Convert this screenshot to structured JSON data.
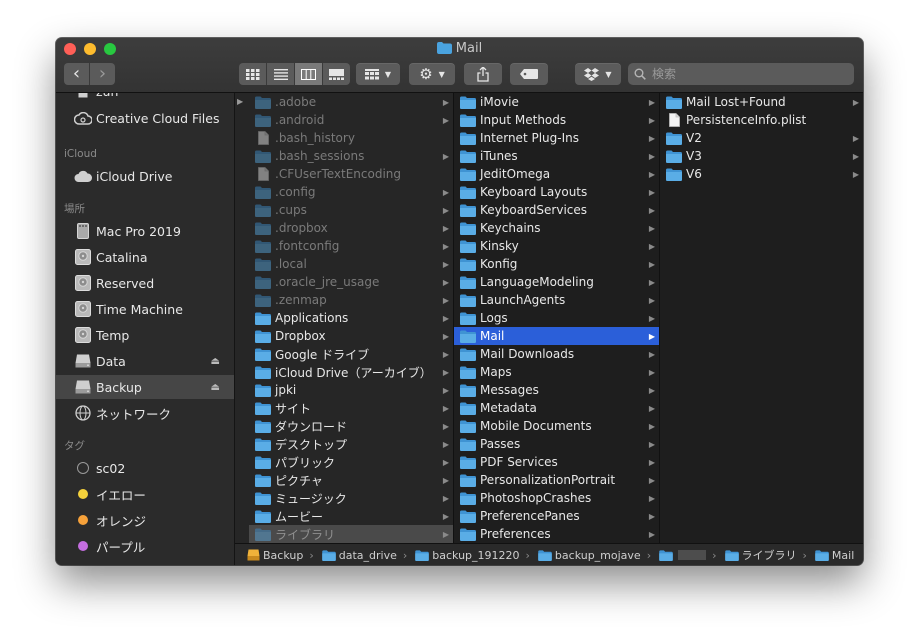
{
  "window": {
    "title": "Mail"
  },
  "toolbar": {
    "back": "‹",
    "forward": "›",
    "search_placeholder": "検索",
    "view_icons": [
      "icon-view-icon",
      "list-view-icon",
      "column-view-icon",
      "gallery-view-icon"
    ]
  },
  "sidebar": {
    "top_items": [
      {
        "label": "zun",
        "icon": "home-icon"
      },
      {
        "label": "Creative Cloud Files",
        "icon": "creative-cloud-icon"
      }
    ],
    "icloud_header": "iCloud",
    "icloud_items": [
      {
        "label": "iCloud Drive",
        "icon": "cloud-icon"
      }
    ],
    "places_header": "場所",
    "places_items": [
      {
        "label": "Mac Pro 2019",
        "icon": "computer-icon",
        "eject": false
      },
      {
        "label": "Catalina",
        "icon": "disk-icon",
        "eject": false
      },
      {
        "label": "Reserved",
        "icon": "disk-icon",
        "eject": false
      },
      {
        "label": "Time Machine",
        "icon": "disk-icon",
        "eject": false
      },
      {
        "label": "Temp",
        "icon": "disk-icon",
        "eject": false
      },
      {
        "label": "Data",
        "icon": "external-drive-icon",
        "eject": true
      },
      {
        "label": "Backup",
        "icon": "external-drive-icon",
        "eject": true,
        "selected": true
      },
      {
        "label": "ネットワーク",
        "icon": "network-icon",
        "eject": false
      }
    ],
    "tags_header": "タグ",
    "tags": [
      {
        "label": "sc02",
        "color": "#2b2b2b",
        "ring": "#9a9a9a"
      },
      {
        "label": "イエロー",
        "color": "#f5d23c"
      },
      {
        "label": "オレンジ",
        "color": "#f6a13a"
      },
      {
        "label": "パープル",
        "color": "#c56ee0"
      }
    ]
  },
  "columns": {
    "col1": [
      {
        "label": ".adobe",
        "type": "folder",
        "dim": true,
        "arrow": true
      },
      {
        "label": ".android",
        "type": "folder",
        "dim": true,
        "arrow": true
      },
      {
        "label": ".bash_history",
        "type": "file",
        "dim": true,
        "arrow": false
      },
      {
        "label": ".bash_sessions",
        "type": "folder",
        "dim": true,
        "arrow": true
      },
      {
        "label": ".CFUserTextEncoding",
        "type": "file",
        "dim": true,
        "arrow": false
      },
      {
        "label": ".config",
        "type": "folder",
        "dim": true,
        "arrow": true
      },
      {
        "label": ".cups",
        "type": "folder",
        "dim": true,
        "arrow": true
      },
      {
        "label": ".dropbox",
        "type": "folder",
        "dim": true,
        "arrow": true
      },
      {
        "label": ".fontconfig",
        "type": "folder",
        "dim": true,
        "arrow": true
      },
      {
        "label": ".local",
        "type": "folder",
        "dim": true,
        "arrow": true
      },
      {
        "label": ".oracle_jre_usage",
        "type": "folder",
        "dim": true,
        "arrow": true
      },
      {
        "label": ".zenmap",
        "type": "folder",
        "dim": true,
        "arrow": true
      },
      {
        "label": "Applications",
        "type": "folder",
        "arrow": true
      },
      {
        "label": "Dropbox",
        "type": "folder",
        "arrow": true
      },
      {
        "label": "Google ドライブ",
        "type": "folder",
        "arrow": true
      },
      {
        "label": "iCloud Drive（アーカイブ）",
        "type": "folder",
        "arrow": true
      },
      {
        "label": "jpki",
        "type": "folder",
        "arrow": true
      },
      {
        "label": "サイト",
        "type": "folder",
        "arrow": true
      },
      {
        "label": "ダウンロード",
        "type": "folder",
        "arrow": true
      },
      {
        "label": "デスクトップ",
        "type": "folder",
        "arrow": true
      },
      {
        "label": "パブリック",
        "type": "folder",
        "arrow": true
      },
      {
        "label": "ピクチャ",
        "type": "folder",
        "arrow": true
      },
      {
        "label": "ミュージック",
        "type": "folder",
        "arrow": true
      },
      {
        "label": "ムービー",
        "type": "folder",
        "arrow": true
      },
      {
        "label": "ライブラリ",
        "type": "folder",
        "dim": true,
        "arrow": true,
        "inactive_selected": true
      }
    ],
    "col2": [
      {
        "label": "iMovie",
        "type": "folder",
        "arrow": true
      },
      {
        "label": "Input Methods",
        "type": "folder",
        "arrow": true
      },
      {
        "label": "Internet Plug-Ins",
        "type": "folder",
        "arrow": true
      },
      {
        "label": "iTunes",
        "type": "folder",
        "arrow": true
      },
      {
        "label": "JeditOmega",
        "type": "folder",
        "arrow": true
      },
      {
        "label": "Keyboard Layouts",
        "type": "folder",
        "arrow": true
      },
      {
        "label": "KeyboardServices",
        "type": "folder",
        "arrow": true
      },
      {
        "label": "Keychains",
        "type": "folder",
        "arrow": true
      },
      {
        "label": "Kinsky",
        "type": "folder",
        "arrow": true
      },
      {
        "label": "Konfig",
        "type": "folder",
        "arrow": true
      },
      {
        "label": "LanguageModeling",
        "type": "folder",
        "arrow": true
      },
      {
        "label": "LaunchAgents",
        "type": "folder",
        "arrow": true
      },
      {
        "label": "Logs",
        "type": "folder",
        "arrow": true
      },
      {
        "label": "Mail",
        "type": "folder",
        "arrow": true,
        "selected": true
      },
      {
        "label": "Mail Downloads",
        "type": "folder",
        "arrow": true
      },
      {
        "label": "Maps",
        "type": "folder",
        "arrow": true
      },
      {
        "label": "Messages",
        "type": "folder",
        "arrow": true
      },
      {
        "label": "Metadata",
        "type": "folder",
        "arrow": true
      },
      {
        "label": "Mobile Documents",
        "type": "folder",
        "arrow": true
      },
      {
        "label": "Passes",
        "type": "folder",
        "arrow": true
      },
      {
        "label": "PDF Services",
        "type": "folder",
        "arrow": true
      },
      {
        "label": "PersonalizationPortrait",
        "type": "folder",
        "arrow": true
      },
      {
        "label": "PhotoshopCrashes",
        "type": "folder",
        "arrow": true
      },
      {
        "label": "PreferencePanes",
        "type": "folder",
        "arrow": true
      },
      {
        "label": "Preferences",
        "type": "folder",
        "arrow": true
      }
    ],
    "col3": [
      {
        "label": "Mail Lost+Found",
        "type": "folder",
        "arrow": true
      },
      {
        "label": "PersistenceInfo.plist",
        "type": "file",
        "arrow": false
      },
      {
        "label": "V2",
        "type": "folder",
        "arrow": true
      },
      {
        "label": "V3",
        "type": "folder",
        "arrow": true
      },
      {
        "label": "V6",
        "type": "folder",
        "arrow": true
      }
    ]
  },
  "pathbar": [
    {
      "label": "Backup",
      "icon": "drive-icon"
    },
    {
      "label": "data_drive",
      "icon": "folder-icon"
    },
    {
      "label": "backup_191220",
      "icon": "folder-icon"
    },
    {
      "label": "backup_mojave",
      "icon": "folder-icon"
    },
    {
      "label": "",
      "icon": "folder-icon",
      "redacted": true
    },
    {
      "label": "ライブラリ",
      "icon": "folder-icon"
    },
    {
      "label": "Mail",
      "icon": "folder-icon"
    }
  ],
  "colors": {
    "selection": "#2b5fd9",
    "folder": "#4aa3df"
  }
}
